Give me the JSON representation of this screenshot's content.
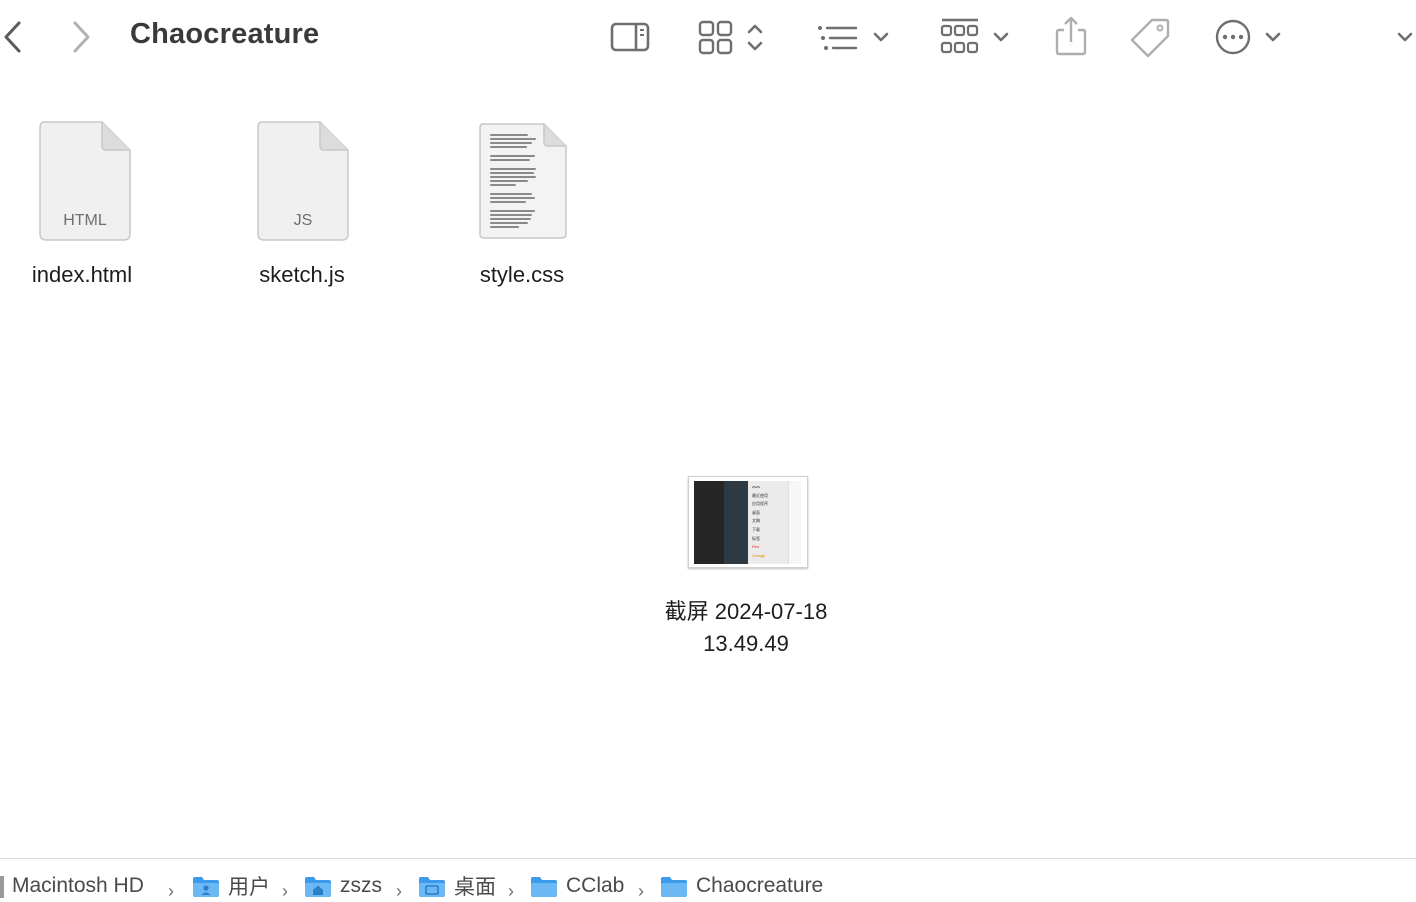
{
  "window": {
    "title": "Chaocreature"
  },
  "toolbar": {
    "back_icon": "chevron-left-icon",
    "forward_icon": "chevron-right-icon",
    "sidebar_icon": "sidebar-toggle-icon",
    "view_icon": "icon-grid-view-icon",
    "sort_icon": "list-sort-icon",
    "group_icon": "group-grid-icon",
    "share_icon": "share-icon",
    "tag_icon": "tag-icon",
    "more_icon": "ellipsis-circle-icon"
  },
  "files": [
    {
      "name": "index.html",
      "kind": "HTML"
    },
    {
      "name": "sketch.js",
      "kind": "JS"
    },
    {
      "name": "style.css",
      "kind": ""
    }
  ],
  "screenshot": {
    "name_line1": "截屏 2024-07-18",
    "name_line2": "13.49.49",
    "thumb_items": [
      "zszs",
      "最近使用",
      "应用程序",
      "桌面",
      "文稿",
      "下载",
      "",
      "标签",
      "Red",
      "Orange"
    ]
  },
  "pathbar": {
    "crumbs": [
      "Macintosh HD",
      "用户",
      "zszs",
      "桌面",
      "CClab",
      "Chaocreature"
    ]
  },
  "colors": {
    "folder_blue": "#3b9bea",
    "icon_gray": "#8e8e93",
    "icon_dim": "#c7c7cc"
  }
}
